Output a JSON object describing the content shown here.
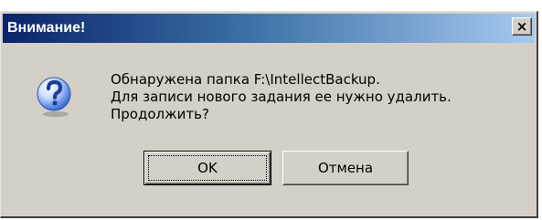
{
  "dialog": {
    "title": "Внимание!",
    "close_label": "×",
    "icon": "question-icon",
    "message_lines": [
      "Обнаружена папка F:\\IntellectBackup.",
      "Для записи нового задания ее нужно удалить.",
      "Продолжить?"
    ],
    "buttons": {
      "ok_label": "OK",
      "cancel_label": "Отмена"
    }
  },
  "colors": {
    "titlebar_start": "#0a246a",
    "titlebar_end": "#a6caf0",
    "face": "#d4d0c8",
    "icon_blue": "#2f62c8"
  }
}
